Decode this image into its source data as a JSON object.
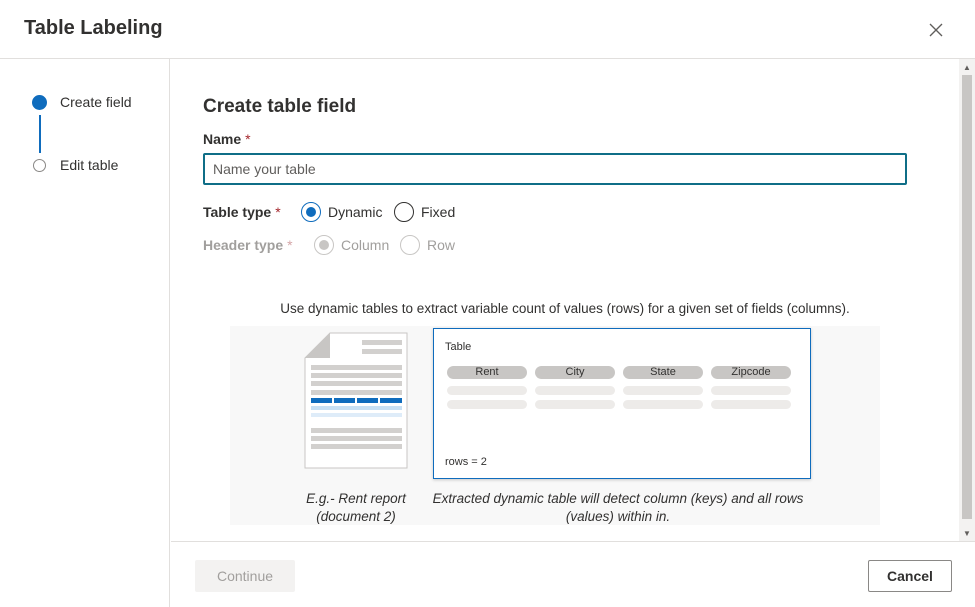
{
  "dialog": {
    "title": "Table Labeling",
    "close_icon": "close-icon"
  },
  "stepper": {
    "steps": [
      {
        "label": "Create field",
        "state": "active"
      },
      {
        "label": "Edit table",
        "state": "inactive"
      }
    ]
  },
  "form": {
    "section_title": "Create table field",
    "name_label": "Name",
    "required_mark": "*",
    "name_placeholder": "Name your table",
    "name_value": "",
    "table_type_label": "Table type",
    "table_type_options": [
      "Dynamic",
      "Fixed"
    ],
    "table_type_selected": "Dynamic",
    "header_type_label": "Header type",
    "header_type_options": [
      "Column",
      "Row"
    ],
    "header_type_selected": "Column",
    "header_type_disabled": true
  },
  "illustration": {
    "help_text": "Use dynamic tables to extract variable count of values (rows) for a given set of fields (columns).",
    "table_title": "Table",
    "columns": [
      "Rent",
      "City",
      "State",
      "Zipcode"
    ],
    "rows_text": "rows = 2",
    "doc_caption": "E.g.- Rent report (document 2)",
    "table_caption": "Extracted dynamic table will detect column (keys) and all rows (values) within in."
  },
  "footer": {
    "continue_label": "Continue",
    "cancel_label": "Cancel"
  },
  "colors": {
    "accent": "#0f6cbd",
    "required": "#a4262c",
    "input_border": "#0f6e87"
  }
}
